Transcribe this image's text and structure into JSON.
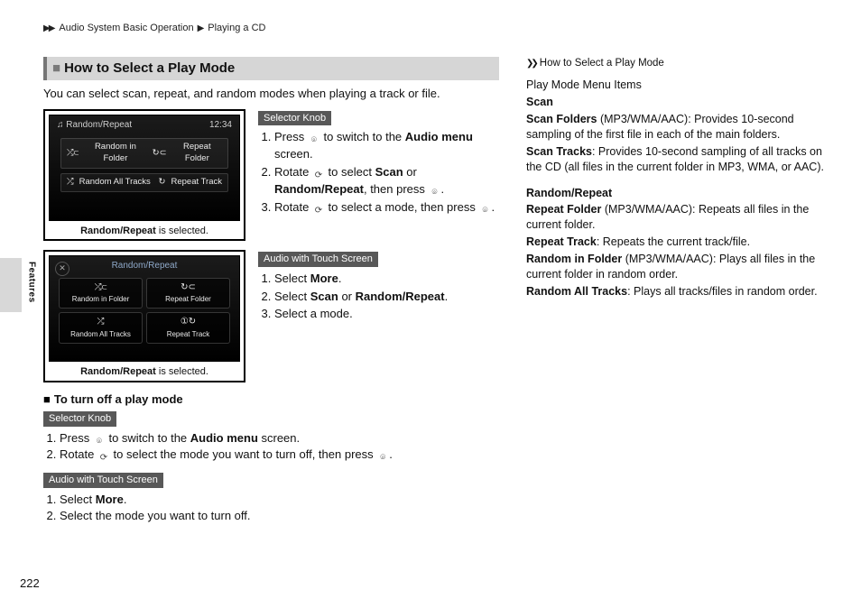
{
  "breadcrumb": {
    "a": "Audio System Basic Operation",
    "b": "Playing a CD"
  },
  "sideLabel": "Features",
  "pageNumber": "222",
  "heading": "How to Select a Play Mode",
  "intro": "You can select scan, repeat, and random modes when playing a track or file.",
  "shot1": {
    "title": "Random/Repeat",
    "clock": "12:34",
    "row1a": "Random in Folder",
    "row1b": "Repeat Folder",
    "row2a": "Random All Tracks",
    "row2b": "Repeat Track",
    "captionPrefix": "Random/Repeat",
    "captionSuffix": " is selected."
  },
  "shot2": {
    "title": "Random/Repeat",
    "b1": "Random in Folder",
    "b2": "Repeat Folder",
    "b3": "Random All Tracks",
    "b4": "Repeat Track",
    "captionPrefix": "Random/Repeat",
    "captionSuffix": " is selected."
  },
  "tags": {
    "selector": "Selector Knob",
    "touch": "Audio with Touch Screen"
  },
  "knobSteps": {
    "s1a": "Press ",
    "s1b": " to switch to the ",
    "s1c": "Audio menu",
    "s1d": " screen.",
    "s2a": "Rotate ",
    "s2b": " to select ",
    "s2c": "Scan",
    "s2d": " or ",
    "s2e": "Random/Repeat",
    "s2f": ", then press ",
    "s2g": ".",
    "s3a": "Rotate ",
    "s3b": " to select a mode, then press ",
    "s3c": "."
  },
  "touchSteps": {
    "s1a": "Select ",
    "s1b": "More",
    "s1c": ".",
    "s2a": "Select ",
    "s2b": "Scan",
    "s2c": " or ",
    "s2d": "Random/Repeat",
    "s2e": ".",
    "s3": "Select a mode."
  },
  "turnOff": {
    "heading": "To turn off a play mode",
    "knob": {
      "s1a": "Press ",
      "s1b": " to switch to the ",
      "s1c": "Audio menu",
      "s1d": " screen.",
      "s2a": "Rotate ",
      "s2b": " to select the mode you want to turn off, then press ",
      "s2c": "."
    },
    "touch": {
      "s1a": "Select ",
      "s1b": "More",
      "s1c": ".",
      "s2": "Select the mode you want to turn off."
    }
  },
  "sidebar": {
    "head": "How to Select a Play Mode",
    "menuTitle": "Play Mode Menu Items",
    "scan": "Scan",
    "scanFoldersLabel": "Scan Folders",
    "scanFoldersText": " (MP3/WMA/AAC): Provides 10-second sampling of the first file in each of the main folders.",
    "scanTracksLabel": "Scan Tracks",
    "scanTracksText": ": Provides 10-second sampling of all tracks on the CD (all files in the current folder in MP3, WMA, or AAC).",
    "rr": "Random/Repeat",
    "repeatFolderLabel": "Repeat Folder",
    "repeatFolderText": " (MP3/WMA/AAC): Repeats all files in the current folder.",
    "repeatTrackLabel": "Repeat Track",
    "repeatTrackText": ": Repeats the current track/file.",
    "randomFolderLabel": "Random in Folder",
    "randomFolderText": " (MP3/WMA/AAC): Plays all files in the current folder in random order.",
    "randomAllLabel": "Random All Tracks",
    "randomAllText": ": Plays all tracks/files in random order."
  }
}
